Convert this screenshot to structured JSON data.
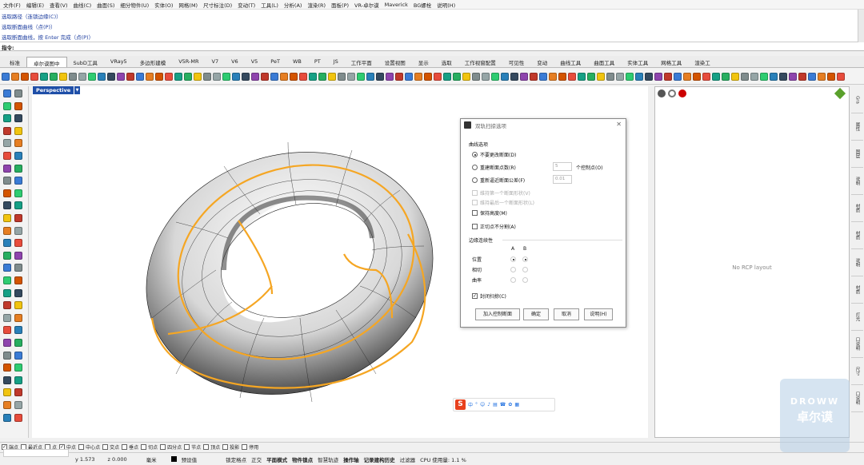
{
  "menu": [
    "文件(F)",
    "编辑(E)",
    "查看(V)",
    "曲线(C)",
    "曲面(S)",
    "细分物件(U)",
    "实体(O)",
    "网格(M)",
    "尺寸标注(D)",
    "变动(T)",
    "工具(L)",
    "分析(A)",
    "渲染(R)",
    "面板(P)",
    "VR-卓尔谟",
    "Maverick",
    "BG螺栓",
    "说明(H)"
  ],
  "command_history": [
    "选取路径（连锁边缘(C)）",
    "选取断面曲线（点(P)）",
    "选取断面曲线，按 Enter 完成（点(P)）"
  ],
  "command_prompt": "指令:",
  "tabs": [
    "标准",
    "卓尔谟图中",
    "SubD工具",
    "VRay5",
    "多边形建模",
    "V5R-MR",
    "V7",
    "V6",
    "V5",
    "PeT",
    "WB",
    "PT",
    "JS",
    "工作平面",
    "设置视图",
    "显示",
    "选取",
    "工作视窗配置",
    "可见性",
    "变动",
    "曲线工具",
    "曲面工具",
    "实体工具",
    "网格工具",
    "渲染工"
  ],
  "active_tab_index": 1,
  "viewport_label": "Perspective",
  "right_panel_text": "No RCP layout",
  "side_tabs": [
    "Gra",
    "属性",
    "图层",
    "说明",
    "材质",
    "材质",
    "说明",
    "材质",
    "灯光",
    "口说明",
    "尺寸",
    "口说明"
  ],
  "dialog": {
    "title": "双轨扫掠选项",
    "curve_options_label": "曲线选项",
    "opt_no_change": "不要更改断面(D)",
    "opt_rebuild_points": "重建断面点数(R)",
    "rebuild_points_value": "5",
    "control_points_label": "个控制点(O)",
    "opt_refit_tolerance": "重新逼近断面公差(F)",
    "refit_value": "0.01",
    "chk_keep_first": "维持第一个断面形状(V)",
    "chk_keep_last": "维持最后一个断面形状(L)",
    "chk_keep_height": "保持高度(M)",
    "chk_split_tangent": "正切点不分割(A)",
    "edge_continuity_label": "边缘连续性",
    "col_a": "A",
    "col_b": "B",
    "row_position": "位置",
    "row_tangent": "相切",
    "row_curvature": "曲率",
    "chk_closed_sweep": "封闭扫掠(C)",
    "btn_add_section": "加入控制断面",
    "btn_ok": "确定",
    "btn_cancel": "取消",
    "btn_help": "说明(H)"
  },
  "ime_items": [
    "中",
    "°",
    "☺",
    "♪",
    "▤",
    "☎",
    "✿",
    "▦"
  ],
  "snaps": [
    {
      "label": "端点",
      "checked": true
    },
    {
      "label": "最近点",
      "checked": false
    },
    {
      "label": "点",
      "checked": false
    },
    {
      "label": "中点",
      "checked": true
    },
    {
      "label": "中心点",
      "checked": false
    },
    {
      "label": "交点",
      "checked": false
    },
    {
      "label": "垂点",
      "checked": false
    },
    {
      "label": "切点",
      "checked": false
    },
    {
      "label": "四分点",
      "checked": false
    },
    {
      "label": "节点",
      "checked": false
    },
    {
      "label": "顶点",
      "checked": false
    },
    {
      "label": "投影",
      "checked": false
    },
    {
      "label": "停用",
      "checked": false
    }
  ],
  "status": {
    "y": "y 1.573",
    "z": "z 0.000",
    "units": "毫米",
    "layer": "预设值",
    "lock_grid": "锁定格点",
    "ortho": "正交",
    "planar": "平面模式",
    "osnap": "物件锁点",
    "smarttrack": "智慧轨迹",
    "gumball": "操作轴",
    "history": "记录建构历史",
    "filter": "过滤器",
    "cpu": "CPU 使用量: 1.1 %"
  },
  "watermark": {
    "line1": "DROWW",
    "line2": "卓尔谟"
  },
  "colors": {
    "accent": "#f5a623",
    "viewport_label_bg": "#1f4fa8",
    "ime_logo": "#e8411e"
  }
}
